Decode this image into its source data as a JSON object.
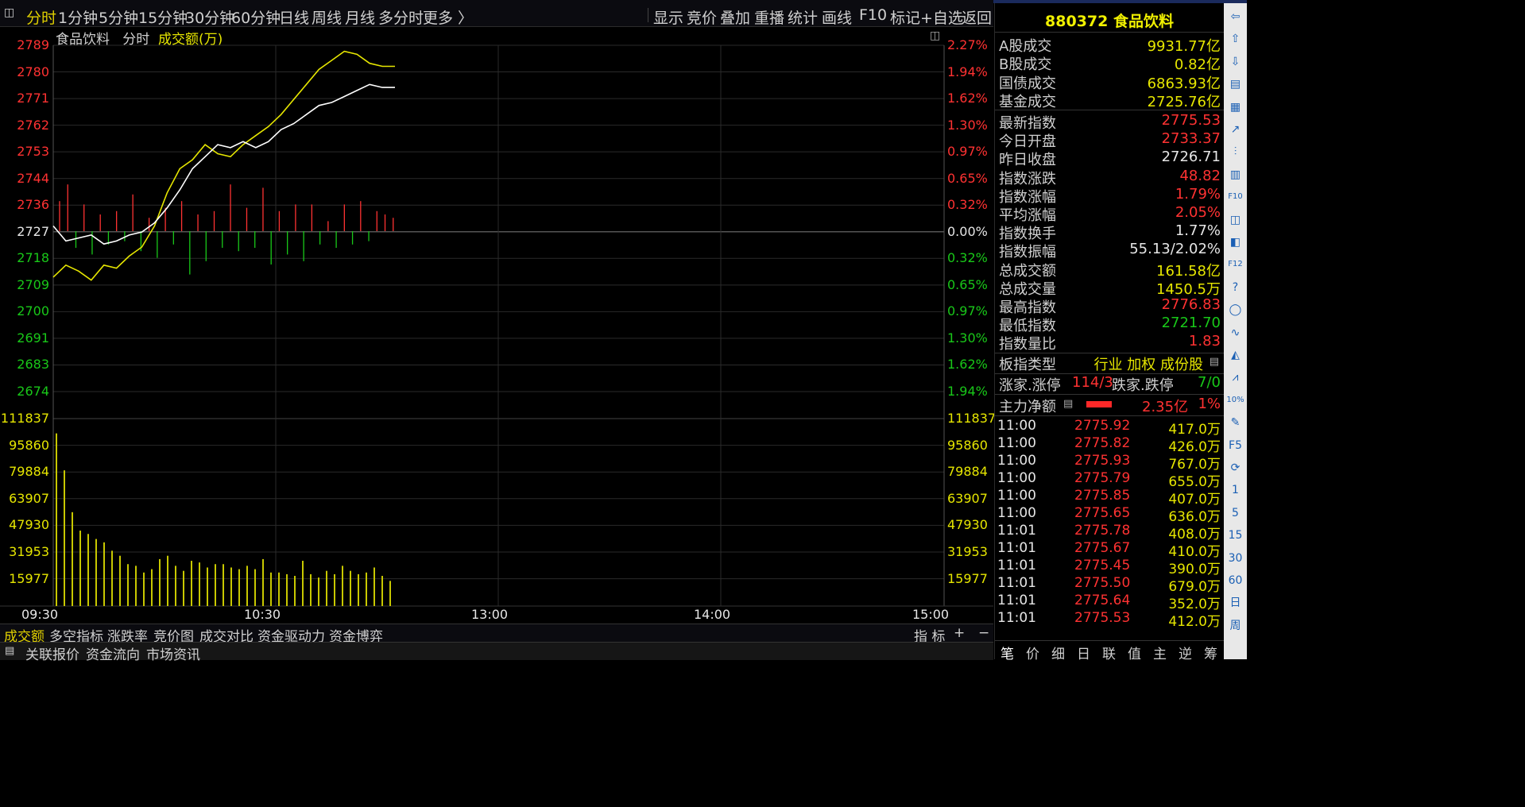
{
  "toolbar": {
    "periods": [
      "分时",
      "1分钟",
      "5分钟",
      "15分钟",
      "30分钟",
      "60分钟",
      "日线",
      "周线",
      "月线",
      "多分时",
      "更多 〉"
    ],
    "actions": [
      "显示",
      "竞价",
      "叠加",
      "重播",
      "统计",
      "画线",
      "F10",
      "标记",
      "+自选",
      "返回"
    ]
  },
  "chart": {
    "name": "食品饮料",
    "mode": "分时",
    "indicator": "成交额(万)",
    "price_ticks": [
      "2789",
      "2780",
      "2771",
      "2762",
      "2753",
      "2744",
      "2736",
      "2727",
      "2718",
      "2709",
      "2700",
      "2691",
      "2683",
      "2674"
    ],
    "pct_ticks": [
      "2.27%",
      "1.94%",
      "1.62%",
      "1.30%",
      "0.97%",
      "0.65%",
      "0.32%",
      "0.00%",
      "0.32%",
      "0.65%",
      "0.97%",
      "1.30%",
      "1.62%",
      "1.94%"
    ],
    "vol_ticks": [
      "111837",
      "95860",
      "79884",
      "63907",
      "47930",
      "31953",
      "15977"
    ],
    "time_ticks": [
      "09:30",
      "10:30",
      "13:00",
      "14:00",
      "15:00"
    ],
    "colors": {
      "up": "#ff3232",
      "down": "#19c819",
      "index_line": "#ffffff",
      "avg_line": "#e6e600",
      "volume": "#c8c800"
    }
  },
  "chart_data": {
    "type": "line",
    "title": "食品饮料",
    "series": [
      {
        "values": [
          2729,
          2724,
          2725,
          2726,
          2723,
          2724,
          2726,
          2727,
          2730,
          2735,
          2741,
          2748,
          2752,
          2756,
          2755,
          2757,
          2755,
          2757,
          2761,
          2763,
          2766,
          2769,
          2770,
          2772,
          2774,
          2776,
          2775,
          2775
        ]
      },
      {
        "values": [
          2712,
          2716,
          2714,
          2711,
          2716,
          2715,
          2719,
          2722,
          2729,
          2740,
          2748,
          2751,
          2756,
          2753,
          2752,
          2756,
          2759,
          2762,
          2766,
          2771,
          2776,
          2781,
          2784,
          2787,
          2786,
          2783,
          2782,
          2782
        ]
      }
    ],
    "ylim": [
      2674,
      2789
    ]
  },
  "volume_data": [
    103000,
    81000,
    56000,
    45000,
    43000,
    40000,
    38000,
    33000,
    30000,
    25000,
    24000,
    20000,
    22000,
    28000,
    30000,
    24000,
    21000,
    27000,
    26000,
    23000,
    25000,
    25000,
    23000,
    22000,
    24000,
    22000,
    28000,
    20000,
    20000,
    19000,
    18000,
    27000,
    19000,
    17000,
    21000,
    19000,
    24000,
    21000,
    19000,
    20000,
    23000,
    18000,
    15000
  ],
  "flow_data": [
    9,
    14,
    -5,
    8,
    -7,
    5,
    -4,
    6,
    -3,
    11,
    -6,
    4,
    -8,
    7,
    -4,
    9,
    -13,
    5,
    -9,
    6,
    -5,
    14,
    -6,
    7,
    -5,
    13,
    -10,
    6,
    -7,
    8,
    -9,
    8,
    -4,
    3,
    -5,
    8,
    -4,
    9,
    -3,
    6,
    5,
    4
  ],
  "bottom_tabs": [
    "成交额",
    "多空指标",
    "涨跌率",
    "竞价图",
    "成交对比",
    "资金驱动力",
    "资金博弈"
  ],
  "bottom_right": [
    "指 标",
    "+",
    "−"
  ],
  "status_tabs": [
    "关联报价",
    "资金流向",
    "市场资讯"
  ],
  "panel": {
    "code_title": "880372 食品饮料",
    "turnover": [
      {
        "label": "A股成交",
        "value": "9931.77亿"
      },
      {
        "label": "B股成交",
        "value": "0.82亿"
      },
      {
        "label": "国债成交",
        "value": "6863.93亿"
      },
      {
        "label": "基金成交",
        "value": "2725.76亿"
      }
    ],
    "stats": [
      {
        "label": "最新指数",
        "value": "2775.53",
        "color": "#ff3232"
      },
      {
        "label": "今日开盘",
        "value": "2733.37",
        "color": "#ff3232"
      },
      {
        "label": "昨日收盘",
        "value": "2726.71",
        "color": "#e6e6e6"
      },
      {
        "label": "指数涨跌",
        "value": "48.82",
        "color": "#ff3232"
      },
      {
        "label": "指数涨幅",
        "value": "1.79%",
        "color": "#ff3232"
      },
      {
        "label": "平均涨幅",
        "value": "2.05%",
        "color": "#ff3232"
      },
      {
        "label": "指数换手",
        "value": "1.77%",
        "color": "#e6e6e6"
      },
      {
        "label": "指数振幅",
        "value": "55.13/2.02%",
        "color": "#e6e6e6"
      },
      {
        "label": "总成交额",
        "value": "161.58亿",
        "color": "#e6e600"
      },
      {
        "label": "总成交量",
        "value": "1450.5万",
        "color": "#e6e600"
      },
      {
        "label": "最高指数",
        "value": "2776.83",
        "color": "#ff3232"
      },
      {
        "label": "最低指数",
        "value": "2721.70",
        "color": "#19c819"
      },
      {
        "label": "指数量比",
        "value": "1.83",
        "color": "#ff3232"
      }
    ],
    "board_label": "板指类型",
    "board_value": "行业 加权 成份股",
    "updown_label1": "涨家.涨停",
    "updown_value1": "114/3",
    "updown_label2": "跌家.跌停",
    "updown_value2": "7/0",
    "main_flow_label": "主力净额",
    "main_flow_value": "2.35亿",
    "main_flow_pct": "1%",
    "ticks": [
      {
        "t": "11:00",
        "p": "2775.92",
        "v": "417.0万"
      },
      {
        "t": "11:00",
        "p": "2775.82",
        "v": "426.0万"
      },
      {
        "t": "11:00",
        "p": "2775.93",
        "v": "767.0万"
      },
      {
        "t": "11:00",
        "p": "2775.79",
        "v": "655.0万"
      },
      {
        "t": "11:00",
        "p": "2775.85",
        "v": "407.0万"
      },
      {
        "t": "11:00",
        "p": "2775.65",
        "v": "636.0万"
      },
      {
        "t": "11:01",
        "p": "2775.78",
        "v": "408.0万"
      },
      {
        "t": "11:01",
        "p": "2775.67",
        "v": "410.0万"
      },
      {
        "t": "11:01",
        "p": "2775.45",
        "v": "390.0万"
      },
      {
        "t": "11:01",
        "p": "2775.50",
        "v": "679.0万"
      },
      {
        "t": "11:01",
        "p": "2775.64",
        "v": "352.0万"
      },
      {
        "t": "11:01",
        "p": "2775.53",
        "v": "412.0万"
      }
    ],
    "tabs": [
      "笔",
      "价",
      "细",
      "日",
      "联",
      "值",
      "主",
      "逆",
      "筹"
    ]
  },
  "sidebar": [
    "⇦",
    "⇧",
    "⇩",
    "▤",
    "▦",
    "↗",
    "⫶",
    "▥",
    "F10",
    "◫",
    "◧",
    "F12",
    "?",
    "◯",
    "∿",
    "◭",
    "⩘",
    "10%",
    "✎",
    "F5",
    "⟳",
    "1",
    "5",
    "15",
    "30",
    "60",
    "日",
    "周"
  ]
}
